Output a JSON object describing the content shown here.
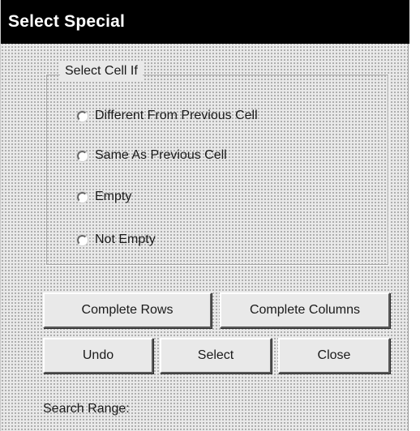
{
  "dialog": {
    "title": "Select Special",
    "group_label": "Select Cell If",
    "options": [
      {
        "label": "Different From Previous Cell",
        "selected": false
      },
      {
        "label": "Same As Previous Cell",
        "selected": false
      },
      {
        "label": "Empty",
        "selected": false
      },
      {
        "label": "Not Empty",
        "selected": false
      }
    ],
    "buttons": {
      "complete_rows": "Complete Rows",
      "complete_columns": "Complete Columns",
      "undo": "Undo",
      "select": "Select",
      "close": "Close"
    },
    "search_range_label": "Search Range:"
  },
  "colors": {
    "title_background": "#000000",
    "title_text": "#ffffff",
    "dialog_background": "#e9e9e9"
  }
}
